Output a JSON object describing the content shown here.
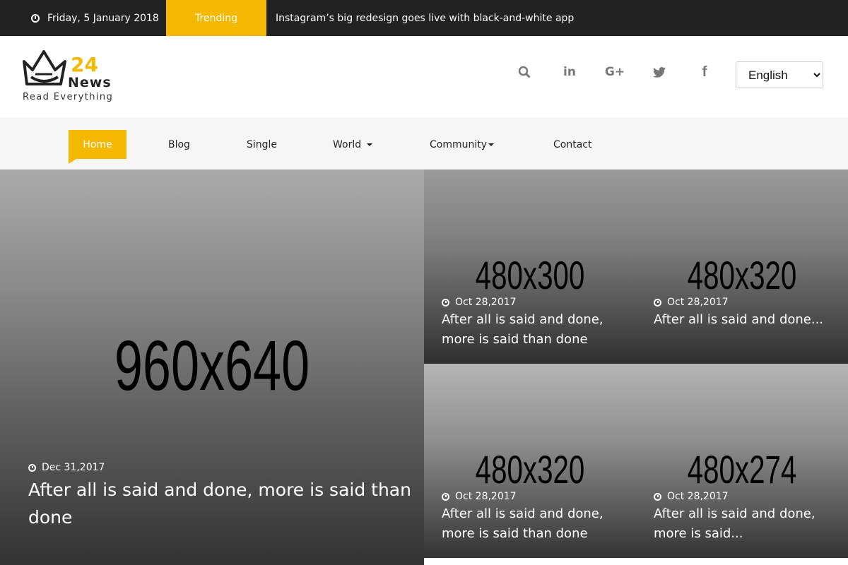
{
  "topbar": {
    "date": "Friday, 5 January 2018",
    "trending_label": "Trending",
    "headline": "Instagram’s big redesign goes live with black-and-white app"
  },
  "logo": {
    "number": "24",
    "brand": "News",
    "tagline": "Read Everything"
  },
  "social": [
    {
      "icon": "search-icon",
      "glyph": "⌕"
    },
    {
      "icon": "linkedin-icon",
      "glyph": "in"
    },
    {
      "icon": "google-plus-icon",
      "glyph": "G+"
    },
    {
      "icon": "twitter-icon",
      "glyph": "🐦"
    },
    {
      "icon": "facebook-icon",
      "glyph": "f"
    }
  ],
  "language": {
    "selected": "English",
    "options": [
      "English"
    ]
  },
  "nav": {
    "home": "Home",
    "blog": "Blog",
    "single": "Single",
    "world": "World",
    "community": "Community",
    "contact": "Contact"
  },
  "cards": {
    "main": {
      "placeholder": "960x640",
      "date": "Dec 31,2017",
      "title": "After all is said and done, more is said than done"
    },
    "top_left": {
      "placeholder": "480x300",
      "date": "Oct 28,2017",
      "title": "After all is said and done, more is said than done"
    },
    "top_right": {
      "placeholder": "480x320",
      "date": "Oct 28,2017",
      "title": "After all is said and done..."
    },
    "bottom_left": {
      "placeholder": "480x320",
      "date": "Oct 28,2017",
      "title": "After all is said and done, more is said than done"
    },
    "bottom_right": {
      "placeholder": "480x274",
      "date": "Oct 28,2017",
      "title": "After all is said and done, more is said..."
    }
  },
  "colors": {
    "accent": "#f5b800",
    "topbar_bg": "#222222",
    "nav_bg": "#f6f6f6"
  }
}
